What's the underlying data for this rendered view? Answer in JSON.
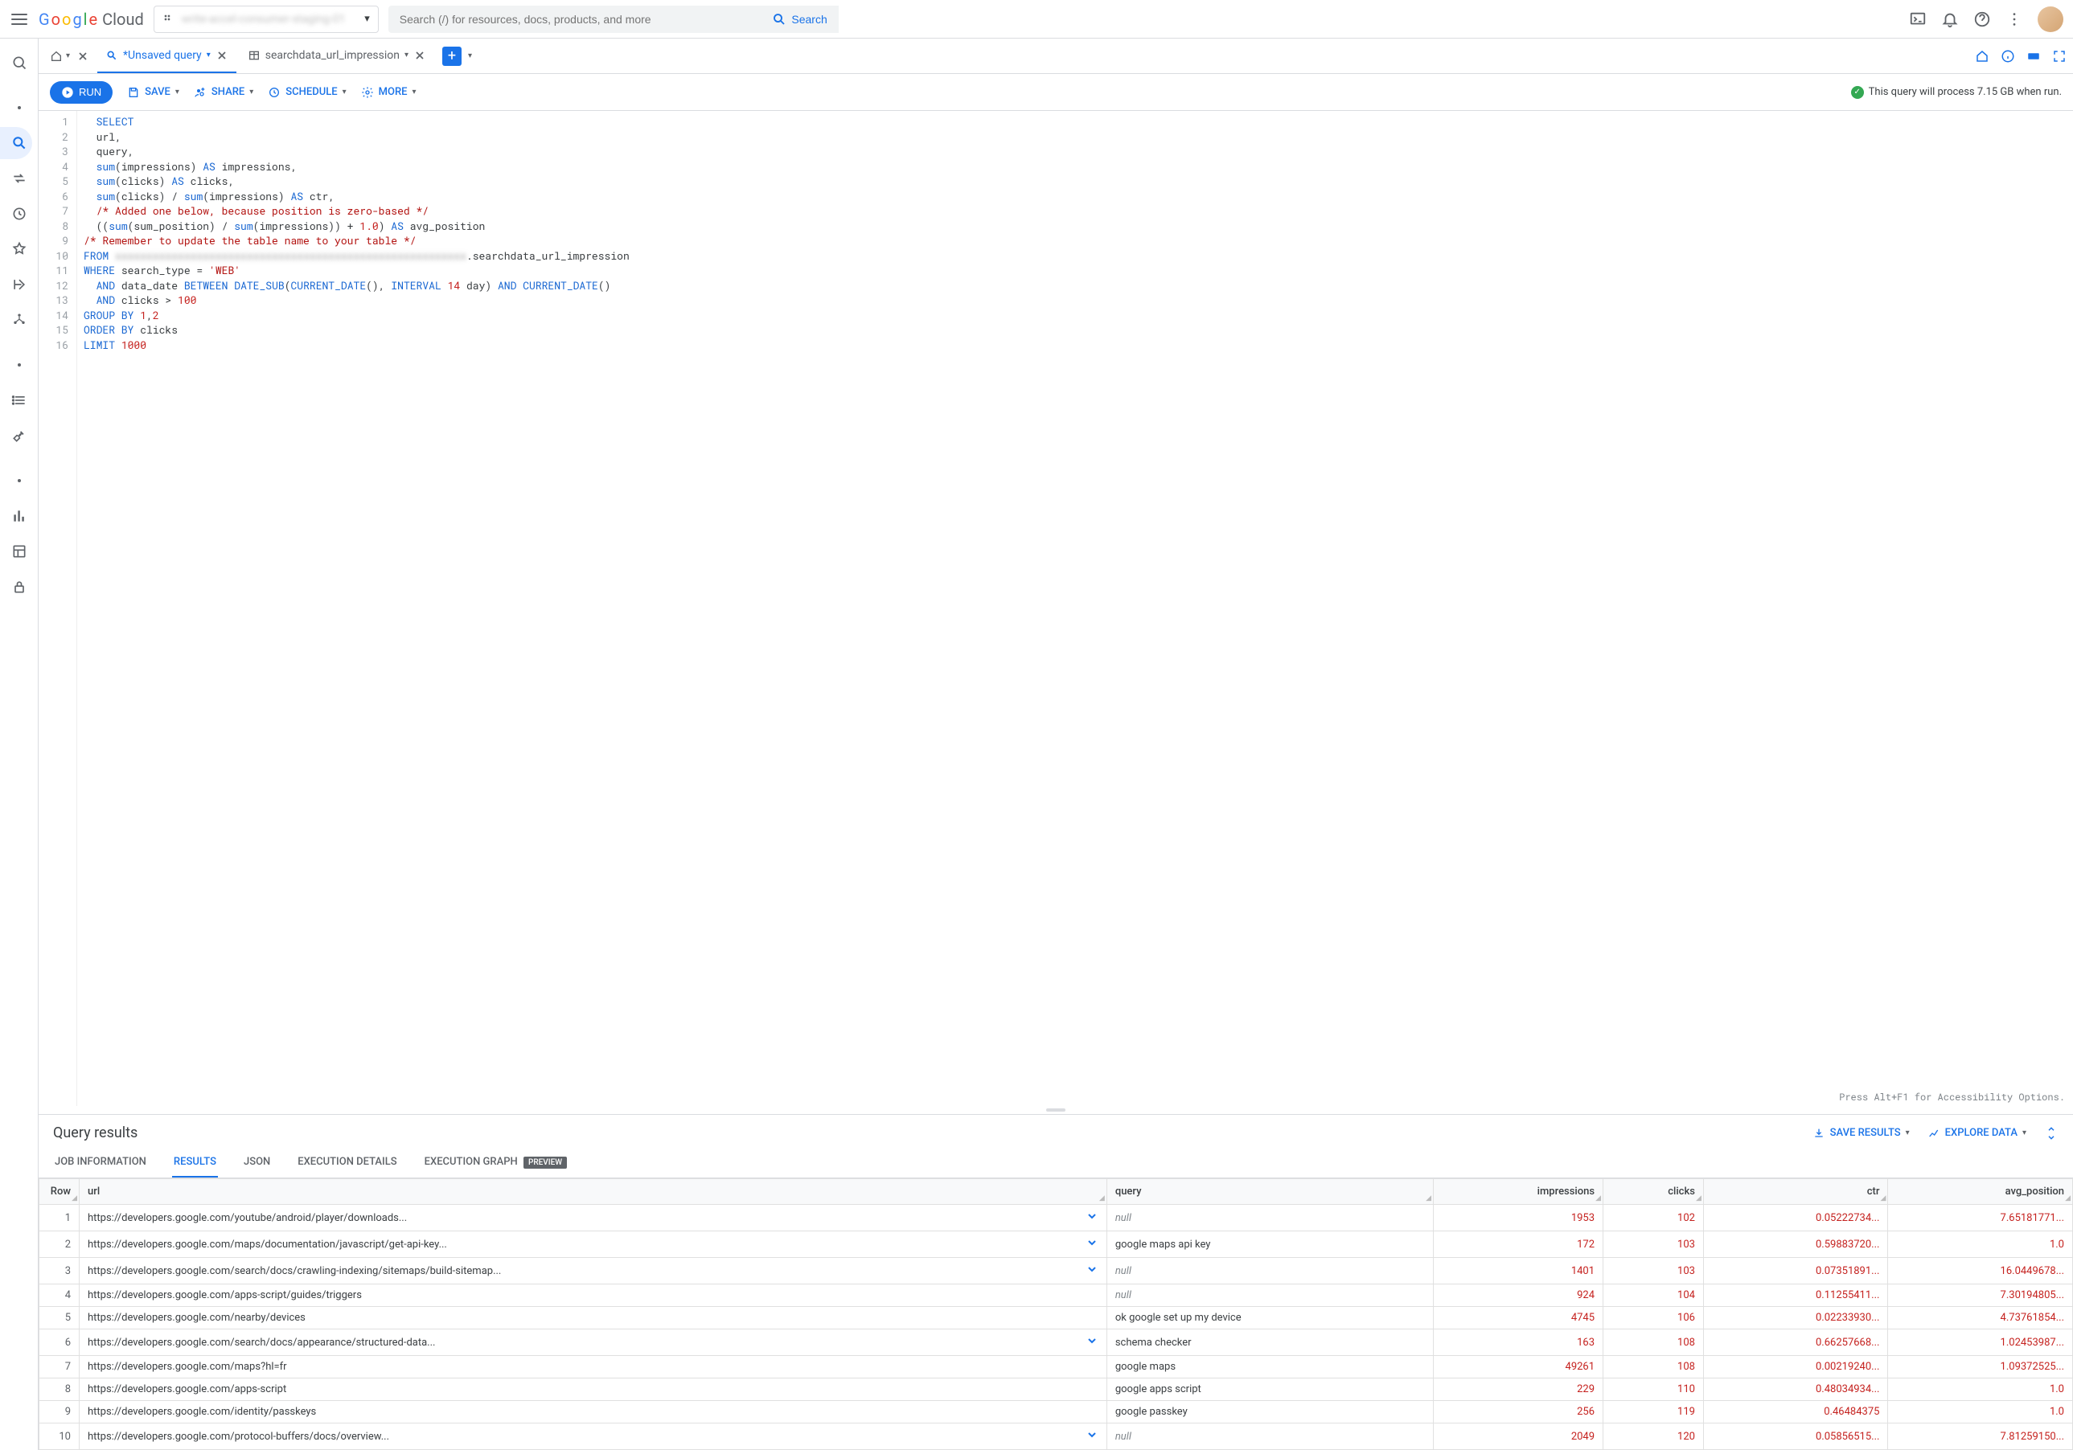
{
  "header": {
    "logo_cloud": "Cloud",
    "project_name": "write-accel-consumer-staging-01",
    "search_placeholder": "Search (/) for resources, docs, products, and more",
    "search_button": "Search"
  },
  "tabs": {
    "unsaved": "*Unsaved query",
    "table_tab": "searchdata_url_impression"
  },
  "toolbar": {
    "run": "RUN",
    "save": "SAVE",
    "share": "SHARE",
    "schedule": "SCHEDULE",
    "more": "MORE",
    "status": "This query will process 7.15 GB when run."
  },
  "editor": {
    "lines": [
      {
        "n": 1,
        "html": "&nbsp;&nbsp;<span class='kw'>SELECT</span>"
      },
      {
        "n": 2,
        "html": "&nbsp;&nbsp;url,"
      },
      {
        "n": 3,
        "html": "&nbsp;&nbsp;query,"
      },
      {
        "n": 4,
        "html": "&nbsp;&nbsp;<span class='fn'>sum</span>(impressions) <span class='kw'>AS</span> impressions,"
      },
      {
        "n": 5,
        "html": "&nbsp;&nbsp;<span class='fn'>sum</span>(clicks) <span class='kw'>AS</span> clicks,"
      },
      {
        "n": 6,
        "html": "&nbsp;&nbsp;<span class='fn'>sum</span>(clicks) / <span class='fn'>sum</span>(impressions) <span class='kw'>AS</span> ctr,"
      },
      {
        "n": 7,
        "html": "&nbsp;&nbsp;<span class='cm'>/* Added one below, because position is zero-based */</span>"
      },
      {
        "n": 8,
        "html": "&nbsp;&nbsp;((<span class='fn'>sum</span>(sum_position) / <span class='fn'>sum</span>(impressions)) + <span class='num'>1.0</span>) <span class='kw'>AS</span> avg_position"
      },
      {
        "n": 9,
        "html": "<span class='cm'>/* Remember to update the table name to your table */</span>"
      },
      {
        "n": 10,
        "html": "<span class='kw'>FROM</span> <span class='blurred'>xxxxxxxxxxxxxxxxxxxxxxxxxxxxxxxxxxxxxxxxxxxxxxxxxxxxxxxx</span>.searchdata_url_impression"
      },
      {
        "n": 11,
        "html": "<span class='kw'>WHERE</span> search_type = <span class='str'>'WEB'</span>"
      },
      {
        "n": 12,
        "html": "&nbsp;&nbsp;<span class='kw'>AND</span> data_date <span class='kw'>BETWEEN</span> <span class='fn'>DATE_SUB</span>(<span class='fn'>CURRENT_DATE</span>(), <span class='kw'>INTERVAL</span> <span class='num'>14</span> day) <span class='kw'>AND</span> <span class='fn'>CURRENT_DATE</span>()"
      },
      {
        "n": 13,
        "html": "&nbsp;&nbsp;<span class='kw'>AND</span> clicks &gt; <span class='num'>100</span>"
      },
      {
        "n": 14,
        "html": "<span class='kw'>GROUP BY</span> <span class='num'>1</span>,<span class='num'>2</span>"
      },
      {
        "n": 15,
        "html": "<span class='kw'>ORDER BY</span> clicks"
      },
      {
        "n": 16,
        "html": "<span class='kw'>LIMIT</span> <span class='num'>1000</span>"
      }
    ],
    "footer": "Press Alt+F1 for Accessibility Options."
  },
  "results": {
    "title": "Query results",
    "save_results": "SAVE RESULTS",
    "explore_data": "EXPLORE DATA",
    "tabs": {
      "job": "JOB INFORMATION",
      "results": "RESULTS",
      "json": "JSON",
      "exec": "EXECUTION DETAILS",
      "graph": "EXECUTION GRAPH",
      "preview": "PREVIEW"
    },
    "columns": [
      "Row",
      "url",
      "query",
      "impressions",
      "clicks",
      "ctr",
      "avg_position"
    ],
    "rows": [
      {
        "row": 1,
        "url": "https://developers.google.com/youtube/android/player/downloads...",
        "expand": true,
        "query": null,
        "impressions": 1953,
        "clicks": 102,
        "ctr": "0.05222734...",
        "avg_position": "7.65181771..."
      },
      {
        "row": 2,
        "url": "https://developers.google.com/maps/documentation/javascript/get-api-key...",
        "expand": true,
        "query": "google maps api key",
        "impressions": 172,
        "clicks": 103,
        "ctr": "0.59883720...",
        "avg_position": "1.0"
      },
      {
        "row": 3,
        "url": "https://developers.google.com/search/docs/crawling-indexing/sitemaps/build-sitemap...",
        "expand": true,
        "query": null,
        "impressions": 1401,
        "clicks": 103,
        "ctr": "0.07351891...",
        "avg_position": "16.0449678..."
      },
      {
        "row": 4,
        "url": "https://developers.google.com/apps-script/guides/triggers",
        "expand": false,
        "query": null,
        "impressions": 924,
        "clicks": 104,
        "ctr": "0.11255411...",
        "avg_position": "7.30194805..."
      },
      {
        "row": 5,
        "url": "https://developers.google.com/nearby/devices",
        "expand": false,
        "query": "ok google set up my device",
        "impressions": 4745,
        "clicks": 106,
        "ctr": "0.02233930...",
        "avg_position": "4.73761854..."
      },
      {
        "row": 6,
        "url": "https://developers.google.com/search/docs/appearance/structured-data...",
        "expand": true,
        "query": "schema checker",
        "impressions": 163,
        "clicks": 108,
        "ctr": "0.66257668...",
        "avg_position": "1.02453987..."
      },
      {
        "row": 7,
        "url": "https://developers.google.com/maps?hl=fr",
        "expand": false,
        "query": "google maps",
        "impressions": 49261,
        "clicks": 108,
        "ctr": "0.00219240...",
        "avg_position": "1.09372525..."
      },
      {
        "row": 8,
        "url": "https://developers.google.com/apps-script",
        "expand": false,
        "query": "google apps script",
        "impressions": 229,
        "clicks": 110,
        "ctr": "0.48034934...",
        "avg_position": "1.0"
      },
      {
        "row": 9,
        "url": "https://developers.google.com/identity/passkeys",
        "expand": false,
        "query": "google passkey",
        "impressions": 256,
        "clicks": 119,
        "ctr": "0.46484375",
        "avg_position": "1.0"
      },
      {
        "row": 10,
        "url": "https://developers.google.com/protocol-buffers/docs/overview...",
        "expand": true,
        "query": null,
        "impressions": 2049,
        "clicks": 120,
        "ctr": "0.05856515...",
        "avg_position": "7.81259150..."
      }
    ]
  }
}
